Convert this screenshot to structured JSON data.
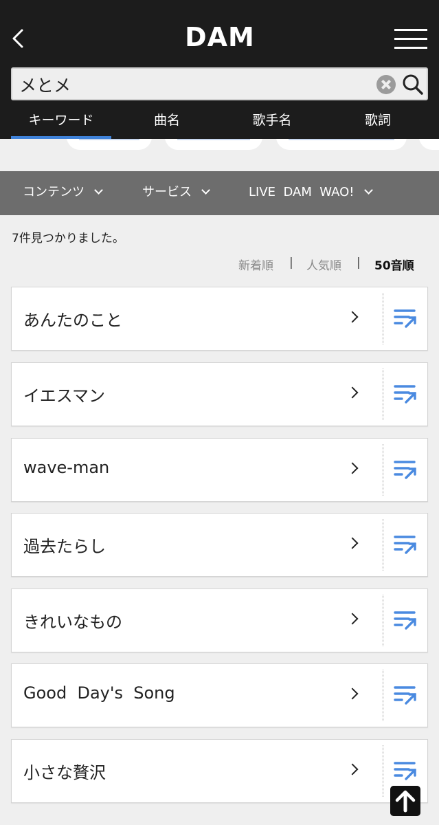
{
  "header": {
    "logo_text": "DAM"
  },
  "search": {
    "value": "メとメ"
  },
  "tabs": [
    {
      "label": "キーワード",
      "active": true
    },
    {
      "label": "曲名",
      "active": false
    },
    {
      "label": "歌手名",
      "active": false
    },
    {
      "label": "歌詞",
      "active": false
    }
  ],
  "filters": [
    {
      "label": "コンテンツ"
    },
    {
      "label": "サービス"
    },
    {
      "label": "LIVE  DAM  WAO!"
    }
  ],
  "results": {
    "count_text": "7件見つかりました。",
    "sort": [
      {
        "label": "新着順",
        "active": false
      },
      {
        "label": "人気順",
        "active": false
      },
      {
        "label": "50音順",
        "active": true
      }
    ],
    "sort_separator": "|",
    "songs": [
      {
        "title": "あんたのこと"
      },
      {
        "title": "イエスマン"
      },
      {
        "title": "wave-man"
      },
      {
        "title": "過去たらし"
      },
      {
        "title": "きれいなもの"
      },
      {
        "title": "Good  Day's  Song"
      },
      {
        "title": "小さな贅沢"
      }
    ]
  },
  "colors": {
    "accent": "#3f82d9",
    "header_bg": "#1c1c1c",
    "filter_bg": "#6d6d6d",
    "queue_icon": "#4a8ae0"
  }
}
